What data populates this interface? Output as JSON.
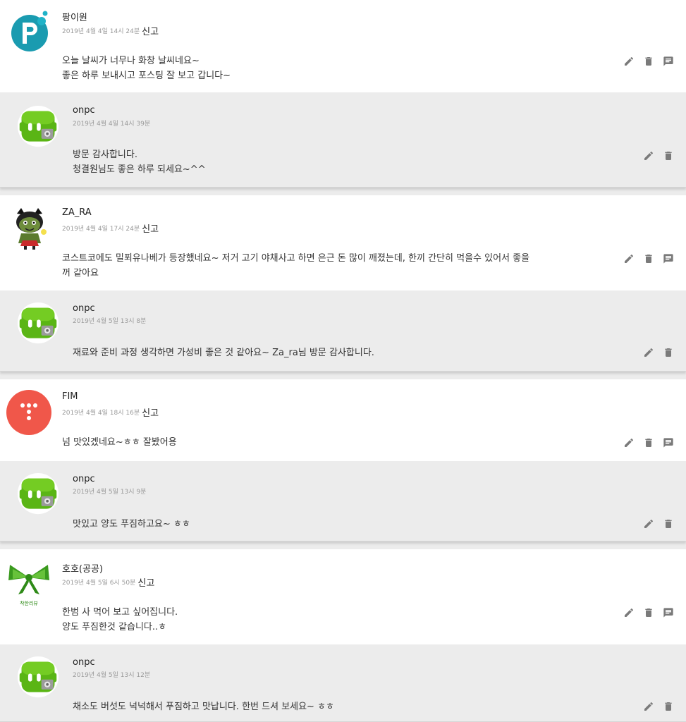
{
  "comments": [
    {
      "author": "팡이원",
      "date": "2019년 4월 4일 14시 24분",
      "report": "신고",
      "text": "오늘 날씨가 너무나 화창 날씨네요~\n좋은 하루 보내시고 포스팅 잘 보고 갑니다~",
      "avatar_icon": "p-logo-avatar",
      "reply": {
        "author": "onpc",
        "date": "2019년 4월 4일 14시 39분",
        "text": "방문 감사합니다.\n청결원님도 좋은 하루 되세요~^^"
      }
    },
    {
      "author": "ZA_RA",
      "date": "2019년 4월 4일 17시 24분",
      "report": "신고",
      "text": "코스트코에도 밀푀유나베가 등장했네요~ 저거 고기 야채사고 하면 은근 돈 많이 깨졌는데, 한끼 간단히 먹을수 있어서 좋을\n꺼 같아요",
      "avatar_icon": "cartoon-character-avatar",
      "reply": {
        "author": "onpc",
        "date": "2019년 4월 5일 13시 8분",
        "text": "재료와 준비 과정 생각하면 가성비 좋은 것 같아요~ Za_ra님 방문 감사합니다."
      }
    },
    {
      "author": "FIM",
      "date": "2019년 4월 4일 18시 16분",
      "report": "신고",
      "text": "넘 맛있겠네요~ㅎㅎ 잘봤어용",
      "avatar_icon": "red-dots-avatar",
      "reply": {
        "author": "onpc",
        "date": "2019년 4월 5일 13시 9분",
        "text": "맛있고 양도 푸짐하고요~ ㅎㅎ"
      }
    },
    {
      "author": "호호(공공)",
      "date": "2019년 4월 5일 6시 50분",
      "report": "신고",
      "text": "한범 사 먹어 보고 싶어집니다.\n양도 푸짐한것 같습니다..ㅎ",
      "avatar_icon": "green-ribbon-avatar",
      "avatar_caption": "착한리뷰",
      "reply": {
        "author": "onpc",
        "date": "2019년 4월 5일 13시 12분",
        "text": "채소도 버섯도 넉넉해서 푸짐하고 맛납니다. 한번 드셔 보세요~ ㅎㅎ"
      }
    }
  ],
  "icons": {
    "edit": "pencil-icon",
    "delete": "trash-icon",
    "reply": "comment-icon"
  },
  "colors": {
    "reply_background": "#ececec",
    "icon": "#777777",
    "meta_text": "#9a9a9a"
  }
}
